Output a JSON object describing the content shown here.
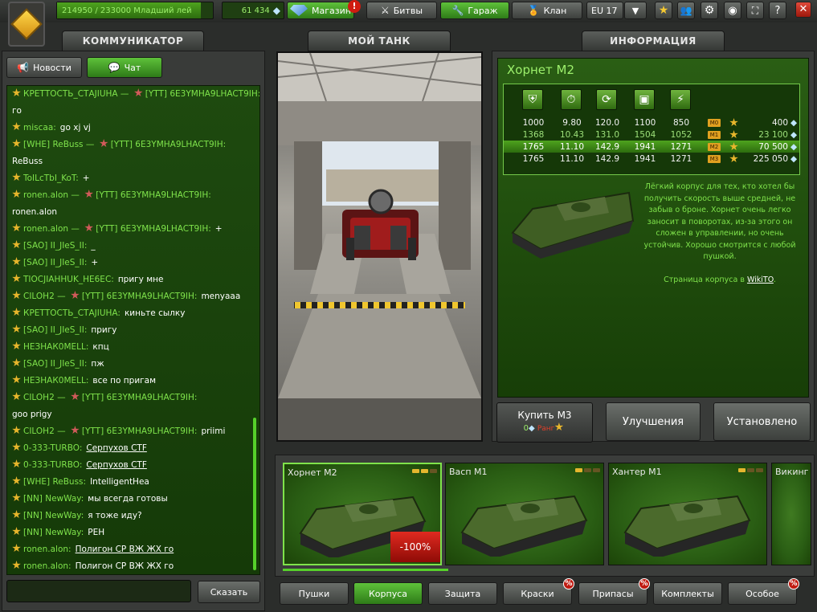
{
  "topbar": {
    "xp_text": "214950 / 233000  Младший лей",
    "xp_progress": 0.922,
    "crystals": "61 434",
    "shop_label": "Магазин",
    "shop_alert": "!",
    "battles_label": "Битвы",
    "garage_label": "Гараж",
    "clan_label": "Клан",
    "server": "EU 17",
    "close_label": "✕"
  },
  "sections": {
    "communicator": "КОММУНИКАТОР",
    "my_tank": "МОЙ ТАНК",
    "info": "ИНФОРМАЦИЯ"
  },
  "communicator": {
    "news_label": "Новости",
    "chat_label": "Чат",
    "send_label": "Сказать",
    "messages": [
      {
        "from": "КРЕТТОСТЬ_СТАJIUHA — ",
        "to": "[YTT] 6E3YMHA9LHACT9IH:",
        "text": ""
      },
      {
        "from": "",
        "to": "",
        "text": "го"
      },
      {
        "from": "miscaa:",
        "to": "",
        "text": "go xj vj"
      },
      {
        "from": "[WHE] ReBuss — ",
        "to": "[YTT] 6E3YMHA9LHACT9IH:",
        "text": ""
      },
      {
        "from": "",
        "to": "",
        "text": "ReBuss"
      },
      {
        "from": "ToILcTbI_KoT:",
        "to": "",
        "text": "+"
      },
      {
        "from": "ronen.alon — ",
        "to": "[YTT] 6E3YMHA9LHACT9IH:",
        "text": ""
      },
      {
        "from": "",
        "to": "",
        "text": "ronen.alon"
      },
      {
        "from": "ronen.alon — ",
        "to": "[YTT] 6E3YMHA9LHACT9IH:",
        "text": "+"
      },
      {
        "from": "[SAO] II_JIeS_II:",
        "to": "",
        "text": "_"
      },
      {
        "from": "[SAO] II_JIeS_II:",
        "to": "",
        "text": "+"
      },
      {
        "from": "TIOCJIAHHUK_HE6EC:",
        "to": "",
        "text": "пригу мне"
      },
      {
        "from": "CILOH2 — ",
        "to": "[YTT] 6E3YMHA9LHACT9IH:",
        "text": "menyaaa"
      },
      {
        "from": "КРЕТТОСТЬ_СТАJIUHA:",
        "to": "",
        "text": "киньте сылку"
      },
      {
        "from": "[SAO] II_JIeS_II:",
        "to": "",
        "text": "пригу"
      },
      {
        "from": "НЕЗНАК0MELL:",
        "to": "",
        "text": "кпц"
      },
      {
        "from": "[SAO] II_JIeS_II:",
        "to": "",
        "text": "пж"
      },
      {
        "from": "НЕЗНАК0MELL:",
        "to": "",
        "text": "все по пригам"
      },
      {
        "from": "CILOH2 — ",
        "to": "[YTT] 6E3YMHA9LHACT9IH:",
        "text": ""
      },
      {
        "from": "",
        "to": "",
        "text": "goo prigy"
      },
      {
        "from": "CILOH2 — ",
        "to": "[YTT] 6E3YMHA9LHACT9IH:",
        "text": "priimi"
      },
      {
        "from": "0-333-TURBO:",
        "to": "",
        "text": "Серпухов CTF"
      },
      {
        "from": "0-333-TURBO:",
        "to": "",
        "text": "Серпухов CTF"
      },
      {
        "from": "[WHE] ReBuss:",
        "to": "",
        "text": "IntelligentHea"
      },
      {
        "from": "[NN] NewWay:",
        "to": "",
        "text": "мы всегда готовы"
      },
      {
        "from": "[NN] NewWay:",
        "to": "",
        "text": "я тоже иду?"
      },
      {
        "from": "[NN] NewWay:",
        "to": "",
        "text": "PEH"
      },
      {
        "from": "ronen.alon:",
        "to": "",
        "text": "Полигон CP ВЖ ЖХ го"
      },
      {
        "from": "ronen.alon:",
        "to": "",
        "text": "Полигон CP ВЖ ЖХ го"
      }
    ]
  },
  "info": {
    "title": "Хорнет М2",
    "stats_rows": [
      {
        "c1": "1000",
        "c2": "9.80",
        "c3": "120.0",
        "c4": "1100",
        "c5": "850",
        "mod": "M0",
        "price": "400"
      },
      {
        "c1": "1368",
        "c2": "10.43",
        "c3": "131.0",
        "c4": "1504",
        "c5": "1052",
        "mod": "M1",
        "price": "23 100"
      },
      {
        "c1": "1765",
        "c2": "11.10",
        "c3": "142.9",
        "c4": "1941",
        "c5": "1271",
        "mod": "M2",
        "price": "70 500"
      },
      {
        "c1": "1765",
        "c2": "11.10",
        "c3": "142.9",
        "c4": "1941",
        "c5": "1271",
        "mod": "M3",
        "price": "225 050"
      }
    ],
    "description": "Лёгкий корпус для тех, кто хотел бы получить скорость выше средней, не забыв о броне. Хорнет очень легко заносит в поворотах, из-за этого он сложен в управлении, но очень устойчив. Хорошо смотрится с любой пушкой.",
    "wiki_prefix": "Страница корпуса в ",
    "wiki_link": "WikiTO",
    "wiki_suffix": ".",
    "buy_label": "Купить М3",
    "buy_price": "0",
    "buy_rank": "Ранг",
    "upgrades_label": "Улучшения",
    "installed_label": "Установлено"
  },
  "carousel": {
    "cards": [
      {
        "name": "Хорнет М2",
        "discount": "-100%",
        "grades_on": 2
      },
      {
        "name": "Васп М1",
        "grades_on": 1
      },
      {
        "name": "Хантер М1",
        "grades_on": 1
      },
      {
        "name": "Викинг",
        "grades_on": 0
      }
    ]
  },
  "tabs": [
    {
      "label": "Пушки",
      "badge": ""
    },
    {
      "label": "Корпуса",
      "badge": ""
    },
    {
      "label": "Защита",
      "badge": ""
    },
    {
      "label": "Краски",
      "badge": "%"
    },
    {
      "label": "Припасы",
      "badge": "%"
    },
    {
      "label": "Комплекты",
      "badge": ""
    },
    {
      "label": "Особое",
      "badge": "%"
    }
  ],
  "colors": {
    "accent_green": "#56d02a",
    "text_green": "#7fe34b",
    "panel_green": "#2a5e14",
    "gold": "#e5b62e",
    "red": "#d01c10"
  }
}
